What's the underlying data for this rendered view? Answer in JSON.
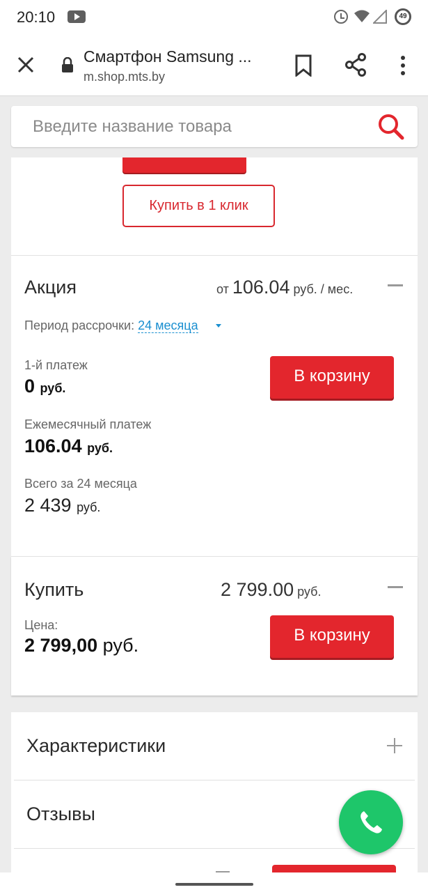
{
  "status_bar": {
    "time": "20:10",
    "battery": "49"
  },
  "browser": {
    "title": "Смартфон Samsung ...",
    "url": "m.shop.mts.by"
  },
  "search": {
    "placeholder": "Введите название товара"
  },
  "top": {
    "oneclick_label": "Купить в 1 клик"
  },
  "promo": {
    "title": "Акция",
    "price_prefix": "от",
    "price": "106.04",
    "price_unit": "руб. / мес.",
    "period_label": "Период рассрочки:",
    "period_value": "24 месяца",
    "first_payment_label": "1-й платеж",
    "first_payment_value": "0",
    "first_payment_unit": "руб.",
    "monthly_label": "Ежемесячный платеж",
    "monthly_value": "106.04",
    "monthly_unit": "руб.",
    "total_label": "Всего за 24 месяца",
    "total_value": "2 439",
    "total_unit": "руб.",
    "cart_label": "В корзину"
  },
  "buy": {
    "title": "Купить",
    "price": "2 799.00",
    "price_unit": "руб.",
    "price_label": "Цена:",
    "price_value": "2 799,00",
    "price_value_unit": "руб.",
    "cart_label": "В корзину"
  },
  "info": {
    "characteristics": "Характеристики",
    "reviews": "Отзывы"
  },
  "colors": {
    "accent_red": "#e3262d",
    "link_blue": "#1a8fd0",
    "call_green": "#1ec66a"
  }
}
